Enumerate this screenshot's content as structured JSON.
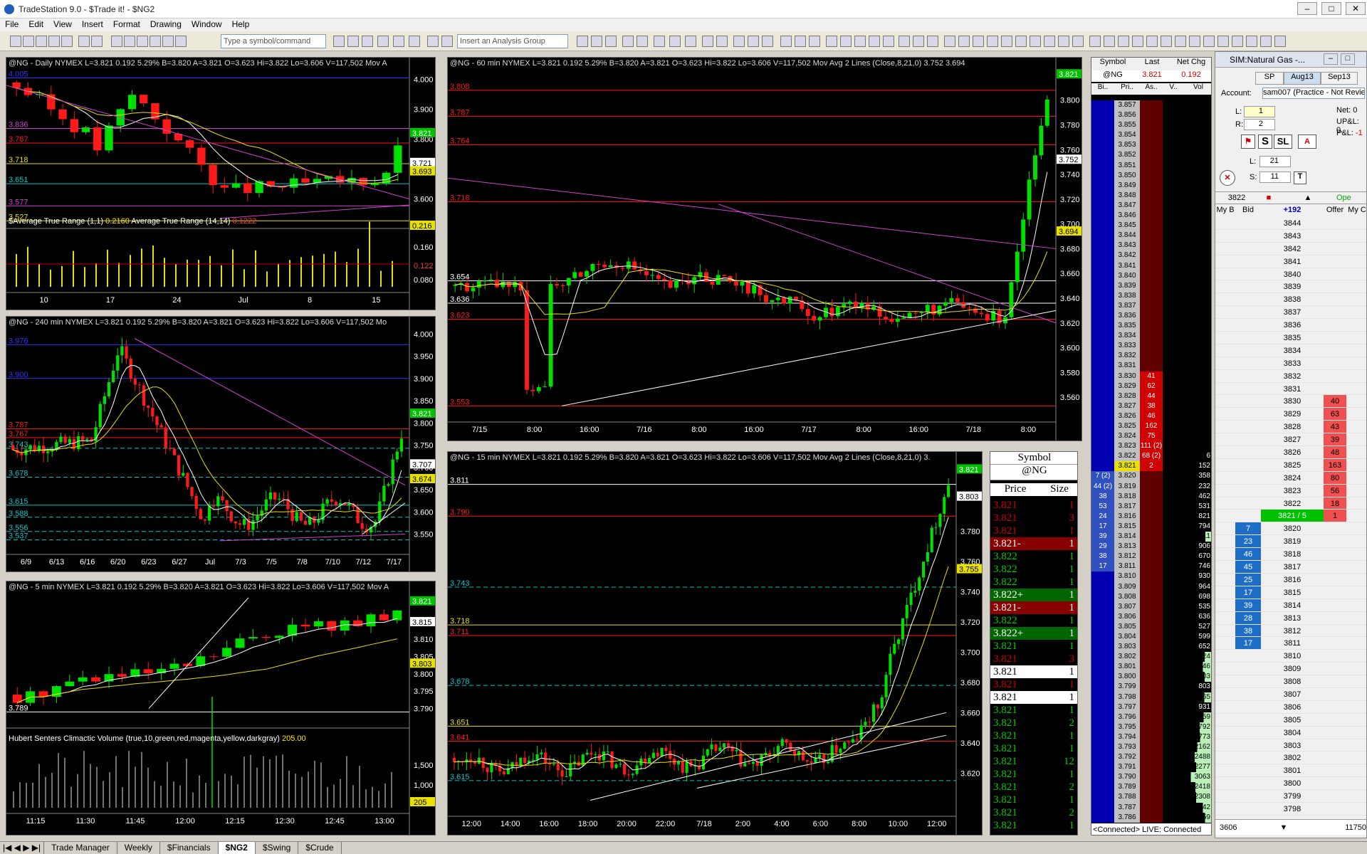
{
  "window": {
    "title": "TradeStation 9.0 - $Trade it! - $NG2"
  },
  "menu": [
    "File",
    "Edit",
    "View",
    "Insert",
    "Format",
    "Drawing",
    "Window",
    "Help"
  ],
  "toolbar": {
    "symbol_placeholder": "Type a symbol/command",
    "analysis_placeholder": "Insert an Analysis Group"
  },
  "quote": {
    "symbol": "@NG",
    "ex": "NYMEX",
    "stats": "L=3.821  0.192  5.29%  B=3.820  A=3.821  O=3.623  Hi=3.822  Lo=3.606  V=117,502"
  },
  "charts": {
    "daily": {
      "header": "@NG - Daily  NYMEX  L=3.821  0.192  5.29%  B=3.820  A=3.821  O=3.623  Hi=3.822  Lo=3.606  V=117,502  Mov A",
      "sub": "$Average True Range (1,1)",
      "sub_v1": "0.2160",
      "sub_s2": "Average True Range (14,14)",
      "sub_v2": "0.1222",
      "yticks": [
        "4.000",
        "3.900",
        "3.800",
        "3.700",
        "3.600"
      ],
      "ylevels": [
        "4.005",
        "3.836",
        "3.787",
        "3.718",
        "3.651",
        "3.577",
        "3.527"
      ],
      "tags": [
        "3.821",
        "3.721",
        "3.693"
      ],
      "sub_ticks": [
        "0.216",
        "0.160",
        "0.122",
        "0.080"
      ],
      "xticks": [
        "10",
        "17",
        "24",
        "Jul",
        "8",
        "15"
      ]
    },
    "h240": {
      "header": "@NG - 240 min  NYMEX  L=3.821  0.192  5.29%  B=3.820  A=3.821  O=3.623  Hi=3.822  Lo=3.606  V=117,502  Mo",
      "yticks": [
        "4.000",
        "3.950",
        "3.900",
        "3.850",
        "3.800",
        "3.750",
        "3.700",
        "3.650",
        "3.600",
        "3.550"
      ],
      "ylevels": [
        "3.976",
        "3.900",
        "3.787",
        "3.767",
        "3.743",
        "3.678",
        "3.615",
        "3.588",
        "3.556",
        "3.537"
      ],
      "tags": [
        "3.821",
        "3.707",
        "3.674"
      ],
      "xticks": [
        "6/9",
        "6/13",
        "6/16",
        "6/20",
        "6/23",
        "6/27",
        "Jul",
        "7/3",
        "7/5",
        "7/8",
        "7/10",
        "7/12",
        "7/17"
      ]
    },
    "m5": {
      "header": "@NG - 5 min  NYMEX  L=3.821  0.192  5.29%  B=3.820  A=3.821  O=3.623  Hi=3.822  Lo=3.606  V=117,502  Mov A",
      "sub": "Hubert Senters Climactic Volume (true,10,green,red,magenta,yellow,darkgray)",
      "sub_v1": "205.00",
      "yticks": [
        "3.810",
        "3.805",
        "3.800",
        "3.795",
        "3.790"
      ],
      "ylevels": [
        "3.789"
      ],
      "tags": [
        "3.821",
        "3.815",
        "3.803"
      ],
      "sub_ticks": [
        "1,500",
        "1,000",
        "500"
      ],
      "sub_tag": "205",
      "xticks": [
        "11:15",
        "11:30",
        "11:45",
        "12:00",
        "12:15",
        "12:30",
        "12:45",
        "13:00"
      ]
    },
    "m60": {
      "header": "@NG - 60 min  NYMEX  L=3.821  0.192  5.29%  B=3.820  A=3.821  O=3.623  Hi=3.822  Lo=3.606  V=117,502  Mov Avg 2 Lines (Close,8,21,0)",
      "mav1": "3.752",
      "mav2": "3.694",
      "yticks": [
        "3.800",
        "3.780",
        "3.760",
        "3.740",
        "3.720",
        "3.700",
        "3.680",
        "3.660",
        "3.640",
        "3.620",
        "3.600",
        "3.580",
        "3.560"
      ],
      "ylevels": [
        "3.808",
        "3.787",
        "3.764",
        "3.718",
        "3.654",
        "3.636",
        "3.623",
        "3.553"
      ],
      "tags": [
        "3.821",
        "3.752",
        "3.694"
      ],
      "xticks": [
        "7/15",
        "8:00",
        "16:00",
        "7/16",
        "8:00",
        "16:00",
        "7/17",
        "8:00",
        "16:00",
        "7/18",
        "8:00"
      ]
    },
    "m15": {
      "header": "@NG - 15 min  NYMEX  L=3.821  0.192  5.29%  B=3.820  A=3.821  O=3.623  Hi=3.822  Lo=3.606  V=117,502  Mov Avg 2 Lines (Close,8,21,0)",
      "mav1": "3.",
      "yticks": [
        "3.780",
        "3.760",
        "3.740",
        "3.720",
        "3.700",
        "3.680",
        "3.660",
        "3.640",
        "3.620"
      ],
      "ylevels": [
        "3.811",
        "3.790",
        "3.743",
        "3.718",
        "3.711",
        "3.678",
        "3.651",
        "3.641",
        "3.615"
      ],
      "tags": [
        "3.821",
        "3.803",
        "3.755"
      ],
      "xticks": [
        "12:00",
        "14:00",
        "16:00",
        "18:00",
        "20:00",
        "22:00",
        "7/18",
        "2:00",
        "4:00",
        "6:00",
        "8:00",
        "10:00",
        "12:00"
      ]
    }
  },
  "tape": {
    "title": "Symbol",
    "symbol": "@NG",
    "col_price": "Price",
    "col_size": "Size",
    "rows": [
      [
        "3.821",
        "1",
        "r"
      ],
      [
        "3.821",
        "3",
        "r"
      ],
      [
        "3.821",
        "1",
        "r"
      ],
      [
        "3.821-",
        "1",
        "R"
      ],
      [
        "3.822",
        "1",
        "g"
      ],
      [
        "3.822",
        "1",
        "g"
      ],
      [
        "3.822",
        "1",
        "g"
      ],
      [
        "3.822+",
        "1",
        "G"
      ],
      [
        "3.821-",
        "1",
        "R"
      ],
      [
        "3.822",
        "1",
        "g"
      ],
      [
        "3.822+",
        "1",
        "G"
      ],
      [
        "3.821",
        "1",
        "g"
      ],
      [
        "3.821",
        "3",
        "r"
      ],
      [
        "3.821",
        "1",
        "w"
      ],
      [
        "3.821",
        "1",
        "r"
      ],
      [
        "3.821",
        "1",
        "w"
      ],
      [
        "3.821",
        "1",
        "g"
      ],
      [
        "3.821",
        "2",
        "g"
      ],
      [
        "3.821",
        "1",
        "g"
      ],
      [
        "3.821",
        "1",
        "g"
      ],
      [
        "3.821",
        "12",
        "g"
      ],
      [
        "3.821",
        "1",
        "g"
      ],
      [
        "3.821",
        "2",
        "g"
      ],
      [
        "3.821",
        "1",
        "g"
      ],
      [
        "3.821",
        "2",
        "g"
      ],
      [
        "3.821",
        "1",
        "g"
      ]
    ]
  },
  "dom": {
    "headers": [
      "Symbol",
      "Last",
      "Net Chg"
    ],
    "symbol": "@NG",
    "last": "3.821",
    "net": "0.192",
    "subheaders": [
      "Bi..",
      "Pri..",
      "As..",
      "V..",
      "Vol"
    ],
    "rows": [
      [
        "",
        "3.857",
        "",
        "",
        ""
      ],
      [
        "",
        "3.856",
        "",
        "",
        ""
      ],
      [
        "",
        "3.855",
        "",
        "",
        ""
      ],
      [
        "",
        "3.854",
        "",
        "",
        ""
      ],
      [
        "",
        "3.853",
        "",
        "",
        ""
      ],
      [
        "",
        "3.852",
        "",
        "",
        ""
      ],
      [
        "",
        "3.851",
        "",
        "",
        ""
      ],
      [
        "",
        "3.850",
        "",
        "",
        ""
      ],
      [
        "",
        "3.849",
        "",
        "",
        ""
      ],
      [
        "",
        "3.848",
        "",
        "",
        ""
      ],
      [
        "",
        "3.847",
        "",
        "",
        ""
      ],
      [
        "",
        "3.846",
        "",
        "",
        ""
      ],
      [
        "",
        "3.845",
        "",
        "",
        ""
      ],
      [
        "",
        "3.844",
        "",
        "",
        ""
      ],
      [
        "",
        "3.843",
        "",
        "",
        ""
      ],
      [
        "",
        "3.842",
        "",
        "",
        ""
      ],
      [
        "",
        "3.841",
        "",
        "",
        ""
      ],
      [
        "",
        "3.840",
        "",
        "",
        ""
      ],
      [
        "",
        "3.839",
        "",
        "",
        ""
      ],
      [
        "",
        "3.838",
        "",
        "",
        ""
      ],
      [
        "",
        "3.837",
        "",
        "",
        ""
      ],
      [
        "",
        "3.836",
        "",
        "",
        ""
      ],
      [
        "",
        "3.835",
        "",
        "",
        ""
      ],
      [
        "",
        "3.834",
        "",
        "",
        ""
      ],
      [
        "",
        "3.833",
        "",
        "",
        ""
      ],
      [
        "",
        "3.832",
        "",
        "",
        ""
      ],
      [
        "",
        "3.831",
        "",
        "",
        ""
      ],
      [
        "",
        "3.830",
        "41",
        "",
        ""
      ],
      [
        "",
        "3.829",
        "62",
        "",
        ""
      ],
      [
        "",
        "3.828",
        "44",
        "",
        ""
      ],
      [
        "",
        "3.827",
        "38",
        "",
        ""
      ],
      [
        "",
        "3.826",
        "46",
        "",
        ""
      ],
      [
        "",
        "3.825",
        "162",
        "",
        ""
      ],
      [
        "",
        "3.824",
        "75",
        "",
        ""
      ],
      [
        "",
        "3.823",
        "111 (2)",
        "",
        ""
      ],
      [
        "",
        "3.822",
        "68 (2)",
        "",
        "6"
      ],
      [
        "",
        "3.821",
        "2",
        "",
        "152"
      ],
      [
        "7 (2)",
        "3.820",
        "",
        "",
        "358"
      ],
      [
        "44 (2)",
        "3.819",
        "",
        "",
        "232"
      ],
      [
        "38",
        "3.818",
        "",
        "",
        "462"
      ],
      [
        "53",
        "3.817",
        "",
        "",
        "531"
      ],
      [
        "24",
        "3.816",
        "",
        "",
        "821"
      ],
      [
        "17",
        "3.815",
        "",
        "",
        "794"
      ],
      [
        "39",
        "3.814",
        "",
        "",
        "1011"
      ],
      [
        "29",
        "3.813",
        "",
        "",
        "906"
      ],
      [
        "38",
        "3.812",
        "",
        "",
        "670"
      ],
      [
        "17",
        "3.811",
        "",
        "",
        "746"
      ],
      [
        "",
        "3.810",
        "",
        "",
        "930"
      ],
      [
        "",
        "3.809",
        "",
        "",
        "964"
      ],
      [
        "",
        "3.808",
        "",
        "",
        "698"
      ],
      [
        "",
        "3.807",
        "",
        "",
        "535"
      ],
      [
        "",
        "3.806",
        "",
        "",
        "636"
      ],
      [
        "",
        "3.805",
        "",
        "",
        "527"
      ],
      [
        "",
        "3.804",
        "",
        "",
        "599"
      ],
      [
        "",
        "3.803",
        "",
        "",
        "652"
      ],
      [
        "",
        "3.802",
        "",
        "",
        "1124"
      ],
      [
        "",
        "3.801",
        "",
        "",
        "1346"
      ],
      [
        "",
        "3.800",
        "",
        "",
        "1103"
      ],
      [
        "",
        "3.799",
        "",
        "",
        "803"
      ],
      [
        "",
        "3.798",
        "",
        "",
        "1165"
      ],
      [
        "",
        "3.797",
        "",
        "",
        "931"
      ],
      [
        "",
        "3.796",
        "",
        "",
        "1259"
      ],
      [
        "",
        "3.795",
        "",
        "",
        "1792"
      ],
      [
        "",
        "3.794",
        "",
        "",
        "1773"
      ],
      [
        "",
        "3.793",
        "",
        "",
        "2162"
      ],
      [
        "",
        "3.792",
        "",
        "",
        "2488"
      ],
      [
        "",
        "3.791",
        "",
        "",
        "2277"
      ],
      [
        "",
        "3.790",
        "",
        "",
        "3063"
      ],
      [
        "",
        "3.789",
        "",
        "",
        "2418"
      ],
      [
        "",
        "3.788",
        "",
        "",
        "2308"
      ],
      [
        "",
        "3.787",
        "",
        "",
        "1342"
      ],
      [
        "",
        "3.786",
        "",
        "",
        "1059"
      ]
    ],
    "status": "<Connected> LIVE: Connected"
  },
  "ladder": {
    "title": "SIM:Natural Gas -...",
    "tab1": "SP",
    "tab2": "Aug13",
    "tab3": "Sep13",
    "account_label": "Account:",
    "account": "sam007 (Practice - Not Revie",
    "l_label": "L:",
    "l_val": "1",
    "r_label": "R:",
    "r_val": "2",
    "net_label": "Net:",
    "net_val": "0",
    "upl_label": "UP&L:",
    "upl_val": "0.",
    "pl_label": "P&L:",
    "pl_val": "-1",
    "l2_label": "L:",
    "l2_val": "21",
    "s2_label": "S:",
    "s2_val": "11",
    "price_box": "3822",
    "open_label": "Ope",
    "col_mybid": "My B",
    "col_bid": "Bid",
    "col_pos": "+192",
    "col_offer": "Offer",
    "col_myo": "My C",
    "rows": [
      [
        "",
        "3844",
        ""
      ],
      [
        "",
        "3843",
        ""
      ],
      [
        "",
        "3842",
        ""
      ],
      [
        "",
        "3841",
        ""
      ],
      [
        "",
        "3840",
        ""
      ],
      [
        "",
        "3839",
        ""
      ],
      [
        "",
        "3838",
        ""
      ],
      [
        "",
        "3837",
        ""
      ],
      [
        "",
        "3836",
        ""
      ],
      [
        "",
        "3835",
        ""
      ],
      [
        "",
        "3834",
        ""
      ],
      [
        "",
        "3833",
        ""
      ],
      [
        "",
        "3832",
        ""
      ],
      [
        "",
        "3831",
        ""
      ],
      [
        "",
        "3830",
        "40"
      ],
      [
        "",
        "3829",
        "63"
      ],
      [
        "",
        "3828",
        "43"
      ],
      [
        "",
        "3827",
        "39"
      ],
      [
        "",
        "3826",
        "48"
      ],
      [
        "",
        "3825",
        "163"
      ],
      [
        "",
        "3824",
        "80"
      ],
      [
        "",
        "3823",
        "56"
      ],
      [
        "",
        "3822",
        "18"
      ],
      [
        "",
        "3821 / 5",
        "1"
      ],
      [
        "7",
        "3820",
        ""
      ],
      [
        "23",
        "3819",
        ""
      ],
      [
        "46",
        "3818",
        ""
      ],
      [
        "45",
        "3817",
        ""
      ],
      [
        "25",
        "3816",
        ""
      ],
      [
        "17",
        "3815",
        ""
      ],
      [
        "39",
        "3814",
        ""
      ],
      [
        "28",
        "3813",
        ""
      ],
      [
        "38",
        "3812",
        ""
      ],
      [
        "17",
        "3811",
        ""
      ],
      [
        "",
        "3810",
        ""
      ],
      [
        "",
        "3809",
        ""
      ],
      [
        "",
        "3808",
        ""
      ],
      [
        "",
        "3807",
        ""
      ],
      [
        "",
        "3806",
        ""
      ],
      [
        "",
        "3805",
        ""
      ],
      [
        "",
        "3804",
        ""
      ],
      [
        "",
        "3803",
        ""
      ],
      [
        "",
        "3802",
        ""
      ],
      [
        "",
        "3801",
        ""
      ],
      [
        "",
        "3800",
        ""
      ],
      [
        "",
        "3799",
        ""
      ],
      [
        "",
        "3798",
        ""
      ]
    ],
    "footer_left": "3606",
    "footer_right": "11750"
  },
  "tabs": [
    "Trade Manager",
    "Weekly",
    "$Financials",
    "$NG2",
    "$Swing",
    "$Crude"
  ],
  "colors": {
    "up": "#00e000",
    "down": "#ff1a1a",
    "magenta": "#d040d0",
    "yellow": "#e8e000",
    "cyan": "#00c8c8",
    "redline": "#c00000",
    "blueline": "#3030ff"
  }
}
